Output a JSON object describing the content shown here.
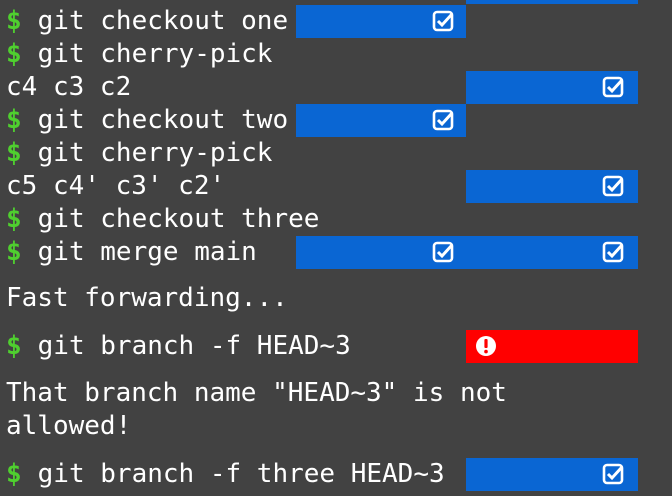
{
  "prompt_symbol": "$",
  "lines": [
    {
      "kind": "cmd",
      "text": "git checkout one"
    },
    {
      "kind": "cmd",
      "text": "git cherry-pick"
    },
    {
      "kind": "out",
      "text": "c4 c3 c2"
    },
    {
      "kind": "cmd",
      "text": "git checkout two"
    },
    {
      "kind": "cmd",
      "text": "git cherry-pick"
    },
    {
      "kind": "out",
      "text": "c5 c4' c3' c2'"
    },
    {
      "kind": "cmd",
      "text": "git checkout three"
    },
    {
      "kind": "cmd",
      "text": "git merge main"
    },
    {
      "kind": "out",
      "text": "Fast forwarding..."
    },
    {
      "kind": "cmd",
      "text": "git branch -f HEAD~3"
    },
    {
      "kind": "out",
      "text": "That branch name \"HEAD~3\" is not"
    },
    {
      "kind": "out",
      "text": "allowed!"
    },
    {
      "kind": "cmd",
      "text": "git branch -f three HEAD~3"
    }
  ],
  "status": {
    "success_color": "#0a66d3",
    "error_color": "#ff0000",
    "success_icon": "checkbox-check-icon",
    "error_icon": "exclamation-circle-icon"
  }
}
